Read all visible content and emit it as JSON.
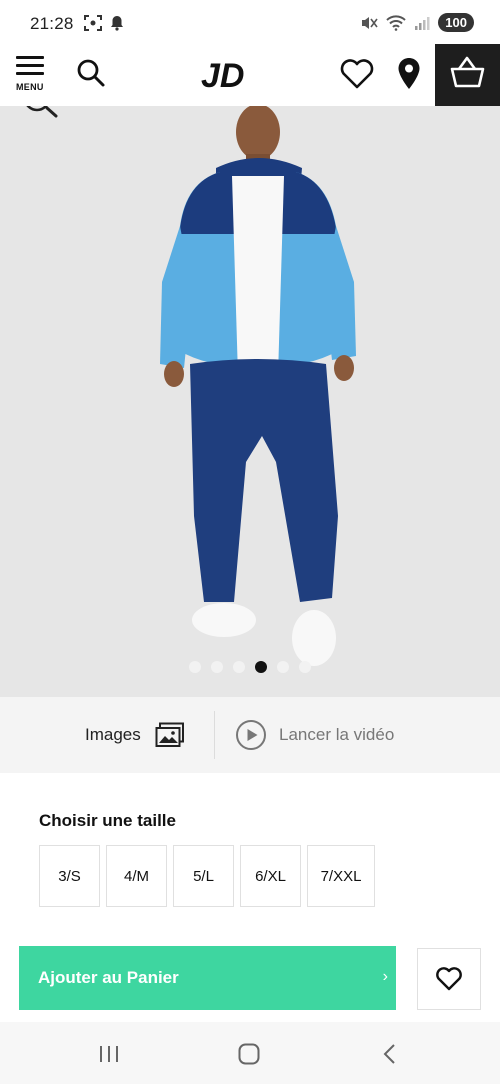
{
  "status_bar": {
    "time": "21:28",
    "battery": "100"
  },
  "header": {
    "menu_label": "MENU",
    "logo_text": "JD"
  },
  "gallery": {
    "dot_count": 6,
    "active_index": 3
  },
  "media": {
    "images_label": "Images",
    "video_label": "Lancer la vidéo"
  },
  "sizes": {
    "title": "Choisir une taille",
    "options": [
      "3/S",
      "4/M",
      "5/L",
      "6/XL",
      "7/XXL"
    ]
  },
  "cart": {
    "add_label": "Ajouter au Panier",
    "chevron": "›"
  },
  "colors": {
    "accent": "#3ed6a0",
    "basket_bg": "#1e1e1e",
    "jacket_light": "#5aaee2",
    "jacket_dark": "#1c3c7e",
    "pants": "#1f3e7e"
  }
}
